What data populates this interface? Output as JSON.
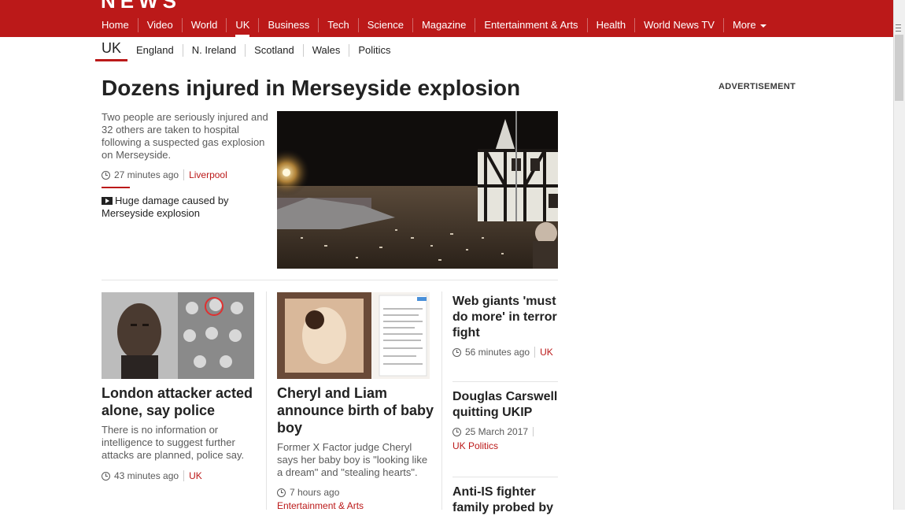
{
  "logo": "NEWS",
  "nav": {
    "items": [
      "Home",
      "Video",
      "World",
      "UK",
      "Business",
      "Tech",
      "Science",
      "Magazine",
      "Entertainment & Arts",
      "Health",
      "World News TV",
      "More"
    ],
    "active": "UK"
  },
  "subnav": {
    "section": "UK",
    "links": [
      "England",
      "N. Ireland",
      "Scotland",
      "Wales",
      "Politics"
    ]
  },
  "lead": {
    "headline": "Dozens injured in Merseyside explosion",
    "summary": "Two people are seriously injured and 32 others are taken to hospital following a suspected gas explosion on Merseyside.",
    "time": "27 minutes ago",
    "tag": "Liverpool",
    "related": "Huge damage caused by Merseyside explosion"
  },
  "advert": "ADVERTISEMENT",
  "stories": [
    {
      "title": "London attacker acted alone, say police",
      "summary": "There is no information or intelligence to suggest further attacks are planned, police say.",
      "time": "43 minutes ago",
      "tag": "UK"
    },
    {
      "title": "Cheryl and Liam announce birth of baby boy",
      "summary": "Former X Factor judge Cheryl says her baby boy is \"looking like a dream\" and \"stealing hearts\".",
      "time": "7 hours ago",
      "tag": "Entertainment & Arts"
    }
  ],
  "side_stories": [
    {
      "title": "Web giants 'must do more' in terror fight",
      "time": "56 minutes ago",
      "tag": "UK"
    },
    {
      "title": "Douglas Carswell quitting UKIP",
      "time": "25 March 2017",
      "tag": "UK Politics"
    },
    {
      "title": "Anti-IS fighter family probed by"
    }
  ]
}
